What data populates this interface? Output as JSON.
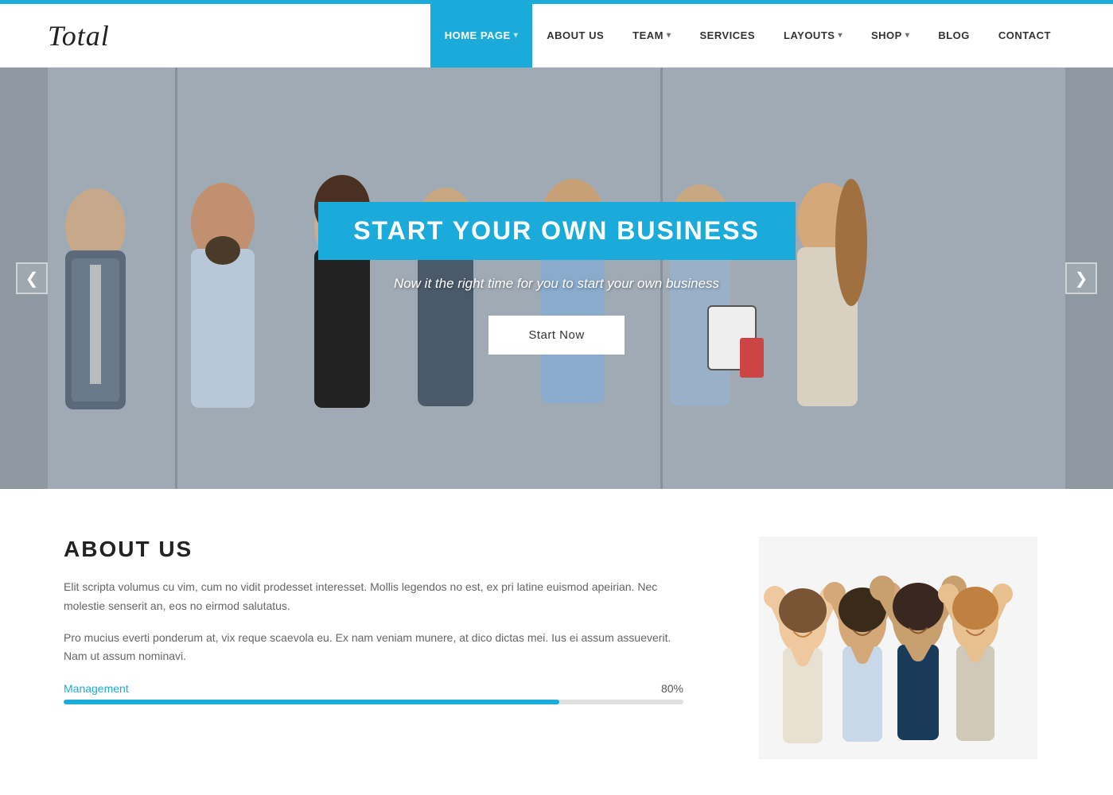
{
  "topBar": {},
  "header": {
    "logo": "Total",
    "nav": {
      "items": [
        {
          "id": "home",
          "label": "HOME PAGE",
          "active": true,
          "hasDropdown": true
        },
        {
          "id": "about",
          "label": "ABOUT US",
          "active": false,
          "hasDropdown": false
        },
        {
          "id": "team",
          "label": "TEAM",
          "active": false,
          "hasDropdown": true
        },
        {
          "id": "services",
          "label": "SERVICES",
          "active": false,
          "hasDropdown": false
        },
        {
          "id": "layouts",
          "label": "LAYOUTS",
          "active": false,
          "hasDropdown": true
        },
        {
          "id": "shop",
          "label": "SHOP",
          "active": false,
          "hasDropdown": true
        },
        {
          "id": "blog",
          "label": "BLOG",
          "active": false,
          "hasDropdown": false
        },
        {
          "id": "contact",
          "label": "CONTACT",
          "active": false,
          "hasDropdown": false
        }
      ]
    }
  },
  "hero": {
    "title": "START YOUR OWN BUSINESS",
    "subtitle": "Now it the right time for you to start your own business",
    "cta_label": "Start Now",
    "arrow_left": "❮",
    "arrow_right": "❯"
  },
  "about": {
    "title": "ABOUT US",
    "paragraph1": "Elit scripta volumus cu vim, cum no vidit prodesset interesset. Mollis legendos no est, ex pri latine euismod apeirian. Nec molestie senserit an, eos no eirmod salutatus.",
    "paragraph2": "Pro mucius everti ponderum at, vix reque scaevola eu. Ex nam veniam munere, at dico dictas mei. Ius ei assum assueverit. Nam ut assum nominavi.",
    "skills": [
      {
        "name": "Management",
        "percent": 80,
        "label": "80%"
      }
    ]
  }
}
